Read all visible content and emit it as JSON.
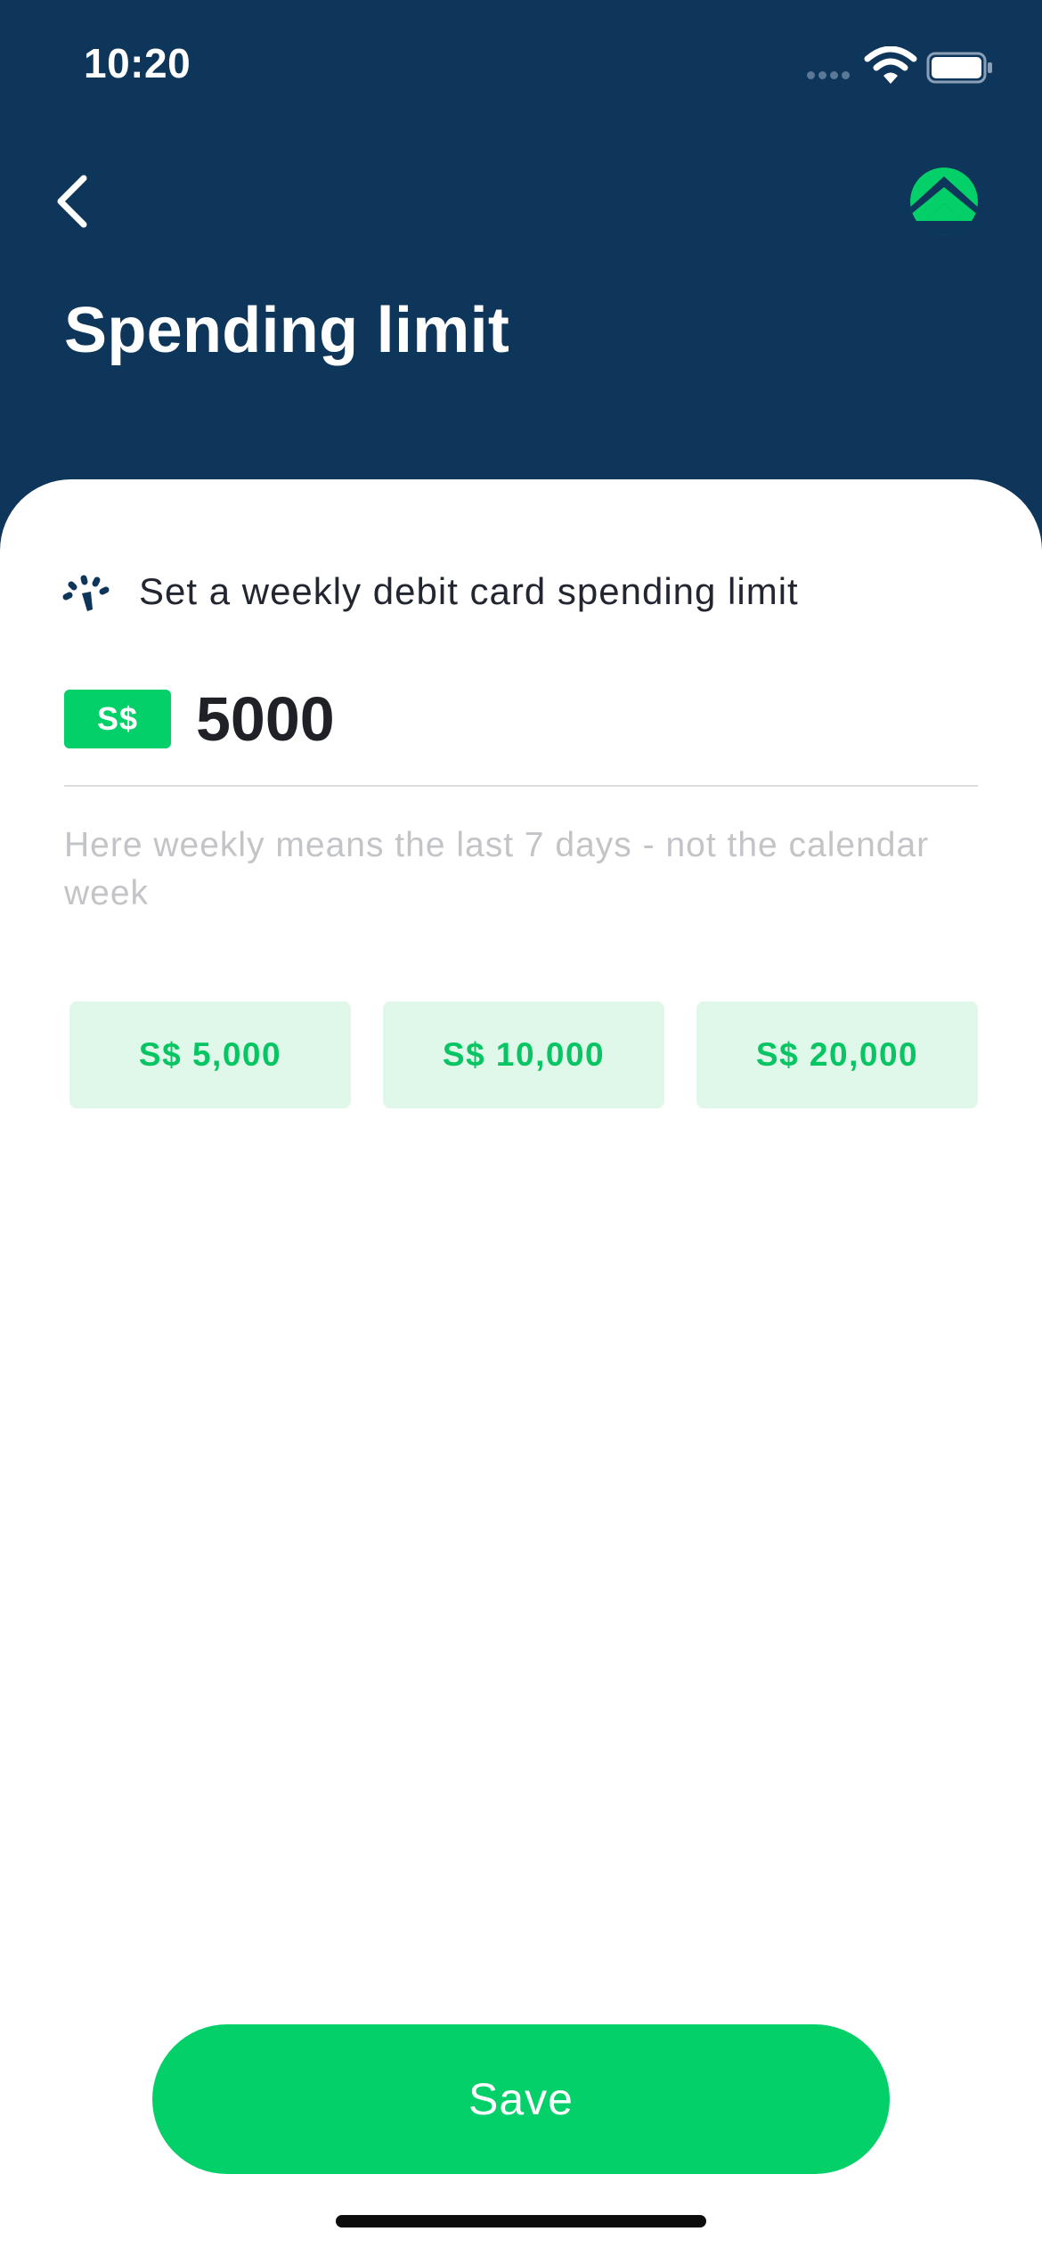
{
  "status_bar": {
    "time": "10:20",
    "icons": [
      "signal-dots-icon",
      "wifi-icon",
      "battery-icon"
    ]
  },
  "header": {
    "title": "Spending limit",
    "back_icon": "chevron-left-icon",
    "logo_icon": "app-logo-icon"
  },
  "limit_section": {
    "icon": "gauge-icon",
    "label": "Set a weekly debit card spending limit",
    "currency": "S$",
    "amount_value": "5000",
    "helper_text": "Here weekly means the last 7 days - not the calendar week"
  },
  "presets": [
    {
      "label": "S$ 5,000"
    },
    {
      "label": "S$ 10,000"
    },
    {
      "label": "S$ 20,000"
    }
  ],
  "footer": {
    "save_label": "Save"
  },
  "colors": {
    "header_bg": "#0e355a",
    "accent_green": "#04d069",
    "preset_bg": "#e0f8ea",
    "preset_text": "#08c563",
    "helper_text": "#c2c4c8"
  }
}
